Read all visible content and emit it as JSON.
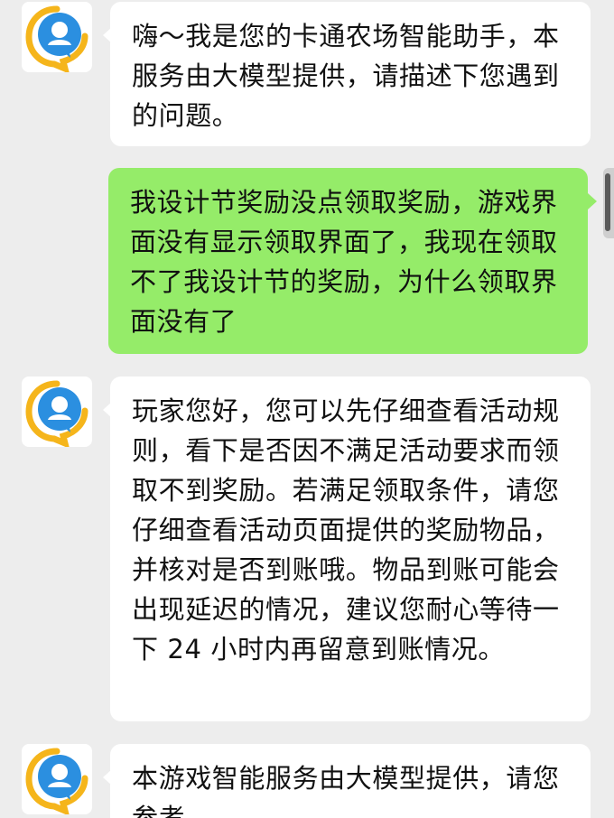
{
  "messages": [
    {
      "role": "assistant",
      "avatar_icon": "assistant-bot-icon",
      "text": "嗨～我是您的卡通农场智能助手，本服务由大模型提供，请描述下您遇到的问题。"
    },
    {
      "role": "user",
      "avatar_icon": "user-avatar-icon",
      "text": "我设计节奖励没点领取奖励，游戏界面没有显示领取界面了，我现在领取不了我设计节的奖励，为什么领取界面没有了"
    },
    {
      "role": "assistant",
      "avatar_icon": "assistant-bot-icon",
      "text": "玩家您好，您可以先仔细查看活动规则，看下是否因不满足活动要求而领取不到奖励。若满足领取条件，请您仔细查看活动页面提供的奖励物品，并核对是否到账哦。物品到账可能会出现延迟的情况，建议您耐心等待一下 24 小时内再留意到账情况。"
    },
    {
      "role": "assistant",
      "avatar_icon": "assistant-bot-icon",
      "text": "本游戏智能服务由大模型提供，请您参考。"
    }
  ],
  "colors": {
    "background": "#ededed",
    "bot_bubble": "#ffffff",
    "user_bubble": "#95ec69",
    "avatar_blue": "#2b8fe0",
    "avatar_yellow": "#f5b51b"
  }
}
